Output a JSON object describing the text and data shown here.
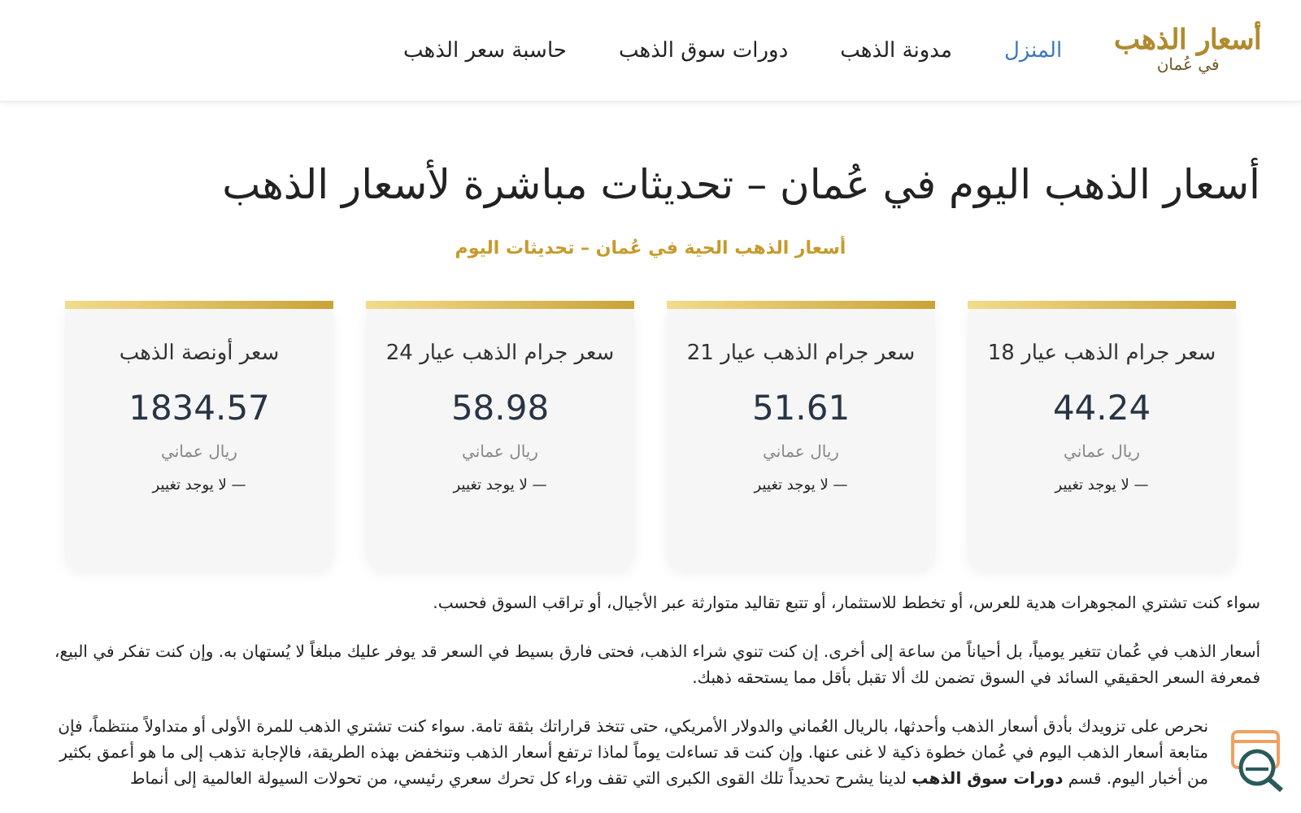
{
  "logo": {
    "title": "أسعار الذهب",
    "subtitle": "في عُمان"
  },
  "nav": [
    {
      "label": "المنزل",
      "selected": true
    },
    {
      "label": "مدونة الذهب",
      "selected": false
    },
    {
      "label": "دورات سوق الذهب",
      "selected": false
    },
    {
      "label": "حاسبة سعر الذهب",
      "selected": false
    }
  ],
  "title": "أسعار الذهب اليوم في عُمان – تحديثات مباشرة لأسعار الذهب",
  "subtitle": "أسعار الذهب الحية في عُمان – تحديثات اليوم",
  "cards": [
    {
      "title": "سعر جرام الذهب عيار 18",
      "value": "44.24",
      "currency": "ريال عماني",
      "change": "— لا يوجد تغيير"
    },
    {
      "title": "سعر جرام الذهب عيار 21",
      "value": "51.61",
      "currency": "ريال عماني",
      "change": "— لا يوجد تغيير"
    },
    {
      "title": "سعر جرام الذهب عيار 24",
      "value": "58.98",
      "currency": "ريال عماني",
      "change": "— لا يوجد تغيير"
    },
    {
      "title": "سعر أونصة الذهب",
      "value": "1834.57",
      "currency": "ريال عماني",
      "change": "— لا يوجد تغيير"
    }
  ],
  "paragraphs": [
    "سواء كنت تشتري المجوهرات هدية للعرس، أو تخطط للاستثمار، أو تتبع تقاليد متوارثة عبر الأجيال، أو تراقب السوق فحسب.",
    "أسعار الذهب في عُمان تتغير يومياً، بل أحياناً من ساعة إلى أخرى. إن كنت تنوي شراء الذهب، فحتى فارق بسيط في السعر قد يوفر عليك مبلغاً لا يُستهان به. وإن كنت تفكر في البيع، فمعرفة السعر الحقيقي السائد في السوق تضمن لك ألا تقبل بأقل مما يستحقه ذهبك.",
    "نحرص على تزويدك بأدق أسعار الذهب وأحدثها، بالريال العُماني والدولار الأمريكي، حتى تتخذ قراراتك بثقة تامة. سواء كنت تشتري الذهب للمرة الأولى أو متداولاً منتظماً، فإن متابعة أسعار الذهب اليوم في عُمان خطوة ذكية لا غنى عنها. وإن كنت قد تساءلت يوماً لماذا ترتفع أسعار الذهب وتنخفض بهذه الطريقة، فالإجابة تذهب إلى ما هو أعمق بكثير من أخبار اليوم. قسم **دورات سوق الذهب** لدينا يشرح تحديداً تلك القوى الكبرى التي تقف وراء كل تحرك سعري رئيسي، من تحولات السيولة العالمية إلى أنماط"
  ]
}
